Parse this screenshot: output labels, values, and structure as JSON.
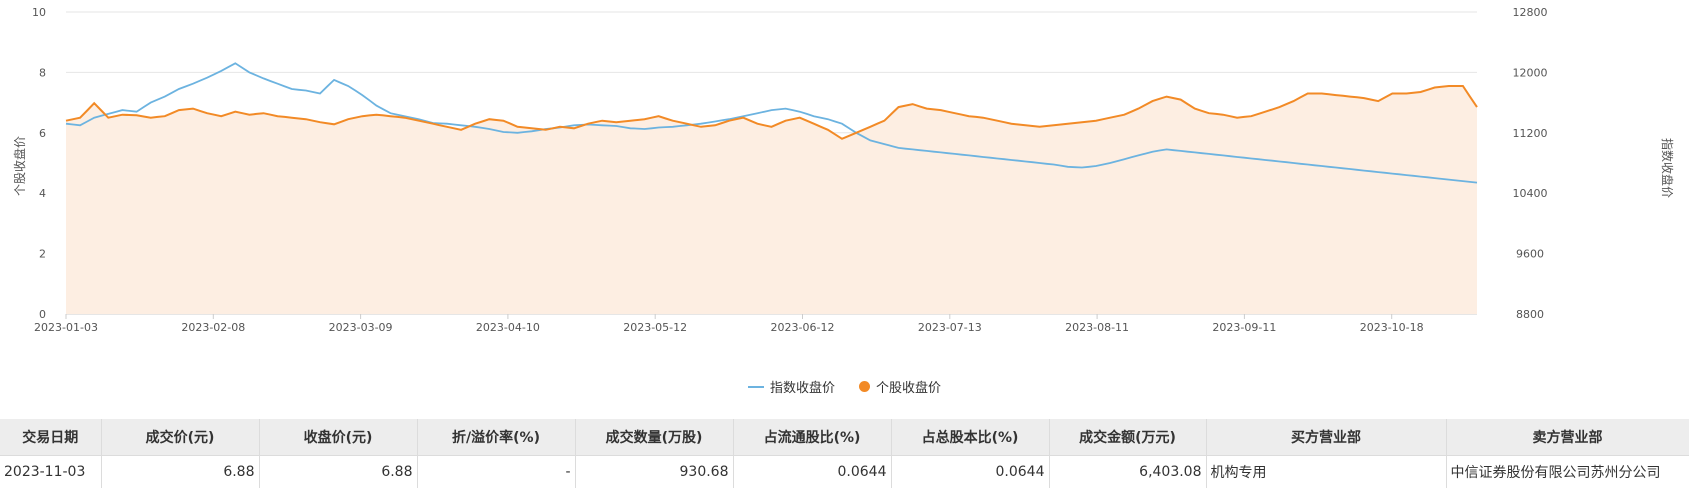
{
  "colors": {
    "index_line": "#6cb3e0",
    "stock_line": "#f28a26",
    "stock_area": "#fdeee2",
    "grid": "#e6e6e6"
  },
  "legend": {
    "index_label": "指数收盘价",
    "stock_label": "个股收盘价"
  },
  "chart_data": {
    "type": "line",
    "x_ticks": [
      "2023-01-03",
      "2023-02-08",
      "2023-03-09",
      "2023-04-10",
      "2023-05-12",
      "2023-06-12",
      "2023-07-13",
      "2023-08-11",
      "2023-09-11",
      "2023-10-18"
    ],
    "n_points": 201,
    "ylabel_left": "个股收盘价",
    "ylabel_right": "指数收盘价",
    "ylim_left": [
      0,
      10
    ],
    "yticks_left": [
      "0",
      "2",
      "4",
      "6",
      "8",
      "10"
    ],
    "ylim_right": [
      8800,
      12800
    ],
    "yticks_right": [
      "8800",
      "9600",
      "10400",
      "11200",
      "12000",
      "12800"
    ],
    "legend_position": "bottom-center",
    "grid": true,
    "series": [
      {
        "name": "个股收盘价",
        "axis": "left",
        "style": "line-area",
        "anchors": [
          [
            0,
            6.4
          ],
          [
            2,
            6.5
          ],
          [
            4,
            6.98
          ],
          [
            6,
            6.5
          ],
          [
            8,
            6.6
          ],
          [
            10,
            6.58
          ],
          [
            12,
            6.5
          ],
          [
            14,
            6.55
          ],
          [
            16,
            6.75
          ],
          [
            18,
            6.8
          ],
          [
            20,
            6.65
          ],
          [
            22,
            6.55
          ],
          [
            24,
            6.7
          ],
          [
            26,
            6.6
          ],
          [
            28,
            6.65
          ],
          [
            30,
            6.55
          ],
          [
            32,
            6.5
          ],
          [
            34,
            6.45
          ],
          [
            36,
            6.35
          ],
          [
            38,
            6.28
          ],
          [
            40,
            6.45
          ],
          [
            42,
            6.55
          ],
          [
            44,
            6.6
          ],
          [
            46,
            6.55
          ],
          [
            48,
            6.5
          ],
          [
            50,
            6.4
          ],
          [
            52,
            6.3
          ],
          [
            54,
            6.2
          ],
          [
            56,
            6.1
          ],
          [
            58,
            6.3
          ],
          [
            60,
            6.45
          ],
          [
            62,
            6.4
          ],
          [
            64,
            6.2
          ],
          [
            66,
            6.15
          ],
          [
            68,
            6.1
          ],
          [
            70,
            6.2
          ],
          [
            72,
            6.15
          ],
          [
            74,
            6.3
          ],
          [
            76,
            6.4
          ],
          [
            78,
            6.35
          ],
          [
            80,
            6.4
          ],
          [
            82,
            6.45
          ],
          [
            84,
            6.55
          ],
          [
            86,
            6.4
          ],
          [
            88,
            6.3
          ],
          [
            90,
            6.2
          ],
          [
            92,
            6.25
          ],
          [
            94,
            6.4
          ],
          [
            96,
            6.5
          ],
          [
            98,
            6.3
          ],
          [
            100,
            6.2
          ],
          [
            102,
            6.4
          ],
          [
            104,
            6.5
          ],
          [
            106,
            6.3
          ],
          [
            108,
            6.1
          ],
          [
            110,
            5.8
          ],
          [
            112,
            6.0
          ],
          [
            114,
            6.2
          ],
          [
            116,
            6.4
          ],
          [
            118,
            6.85
          ],
          [
            120,
            6.95
          ],
          [
            122,
            6.8
          ],
          [
            124,
            6.75
          ],
          [
            126,
            6.65
          ],
          [
            128,
            6.55
          ],
          [
            130,
            6.5
          ],
          [
            132,
            6.4
          ],
          [
            134,
            6.3
          ],
          [
            136,
            6.25
          ],
          [
            138,
            6.2
          ],
          [
            140,
            6.25
          ],
          [
            142,
            6.3
          ],
          [
            144,
            6.35
          ],
          [
            146,
            6.4
          ],
          [
            148,
            6.5
          ],
          [
            150,
            6.6
          ],
          [
            152,
            6.8
          ],
          [
            154,
            7.05
          ],
          [
            156,
            7.2
          ],
          [
            158,
            7.1
          ],
          [
            160,
            6.8
          ],
          [
            162,
            6.65
          ],
          [
            164,
            6.6
          ],
          [
            166,
            6.5
          ],
          [
            168,
            6.55
          ],
          [
            170,
            6.7
          ],
          [
            172,
            6.85
          ],
          [
            174,
            7.05
          ],
          [
            176,
            7.3
          ],
          [
            178,
            7.3
          ],
          [
            180,
            7.25
          ],
          [
            182,
            7.2
          ],
          [
            184,
            7.15
          ],
          [
            186,
            7.05
          ],
          [
            188,
            7.3
          ],
          [
            190,
            7.3
          ],
          [
            192,
            7.35
          ],
          [
            194,
            7.5
          ],
          [
            196,
            7.55
          ],
          [
            198,
            7.55
          ],
          [
            200,
            6.85
          ]
        ]
      },
      {
        "name": "指数收盘价",
        "axis": "right",
        "style": "line",
        "anchors": [
          [
            0,
            11320
          ],
          [
            2,
            11300
          ],
          [
            4,
            11400
          ],
          [
            6,
            11450
          ],
          [
            8,
            11500
          ],
          [
            10,
            11480
          ],
          [
            12,
            11600
          ],
          [
            14,
            11680
          ],
          [
            16,
            11780
          ],
          [
            18,
            11850
          ],
          [
            20,
            11930
          ],
          [
            22,
            12020
          ],
          [
            24,
            12120
          ],
          [
            26,
            12000
          ],
          [
            28,
            11920
          ],
          [
            30,
            11850
          ],
          [
            32,
            11780
          ],
          [
            34,
            11760
          ],
          [
            36,
            11720
          ],
          [
            38,
            11900
          ],
          [
            40,
            11820
          ],
          [
            42,
            11700
          ],
          [
            44,
            11560
          ],
          [
            46,
            11460
          ],
          [
            48,
            11420
          ],
          [
            50,
            11380
          ],
          [
            52,
            11330
          ],
          [
            54,
            11320
          ],
          [
            56,
            11300
          ],
          [
            58,
            11280
          ],
          [
            60,
            11250
          ],
          [
            62,
            11210
          ],
          [
            64,
            11200
          ],
          [
            66,
            11220
          ],
          [
            68,
            11250
          ],
          [
            70,
            11270
          ],
          [
            72,
            11300
          ],
          [
            74,
            11310
          ],
          [
            76,
            11300
          ],
          [
            78,
            11290
          ],
          [
            80,
            11260
          ],
          [
            82,
            11250
          ],
          [
            84,
            11270
          ],
          [
            86,
            11280
          ],
          [
            88,
            11300
          ],
          [
            90,
            11320
          ],
          [
            92,
            11350
          ],
          [
            94,
            11380
          ],
          [
            96,
            11420
          ],
          [
            98,
            11460
          ],
          [
            100,
            11500
          ],
          [
            102,
            11520
          ],
          [
            104,
            11480
          ],
          [
            106,
            11420
          ],
          [
            108,
            11380
          ],
          [
            110,
            11320
          ],
          [
            112,
            11200
          ],
          [
            114,
            11100
          ],
          [
            116,
            11050
          ],
          [
            118,
            11000
          ],
          [
            120,
            10980
          ],
          [
            122,
            10960
          ],
          [
            124,
            10940
          ],
          [
            126,
            10920
          ],
          [
            128,
            10900
          ],
          [
            130,
            10880
          ],
          [
            132,
            10860
          ],
          [
            134,
            10840
          ],
          [
            136,
            10820
          ],
          [
            138,
            10800
          ],
          [
            140,
            10780
          ],
          [
            142,
            10750
          ],
          [
            144,
            10740
          ],
          [
            146,
            10760
          ],
          [
            148,
            10800
          ],
          [
            150,
            10850
          ],
          [
            152,
            10900
          ],
          [
            154,
            10950
          ],
          [
            156,
            10980
          ],
          [
            158,
            10960
          ],
          [
            160,
            10940
          ],
          [
            162,
            10920
          ],
          [
            164,
            10900
          ],
          [
            166,
            10880
          ],
          [
            168,
            10860
          ],
          [
            170,
            10840
          ],
          [
            172,
            10820
          ],
          [
            174,
            10800
          ],
          [
            176,
            10780
          ],
          [
            178,
            10760
          ],
          [
            180,
            10740
          ],
          [
            182,
            10720
          ],
          [
            184,
            10700
          ],
          [
            186,
            10680
          ],
          [
            188,
            10660
          ],
          [
            190,
            10640
          ],
          [
            192,
            10620
          ],
          [
            194,
            10600
          ],
          [
            196,
            10580
          ],
          [
            198,
            10560
          ],
          [
            200,
            10540
          ]
        ]
      }
    ]
  },
  "table": {
    "headers": [
      "交易日期",
      "成交价(元)",
      "收盘价(元)",
      "折/溢价率(%)",
      "成交数量(万股)",
      "占流通股比(%)",
      "占总股本比(%)",
      "成交金额(万元)",
      "买方营业部",
      "卖方营业部"
    ],
    "row": [
      "2023-11-03",
      "6.88",
      "6.88",
      "-",
      "930.68",
      "0.0644",
      "0.0644",
      "6,403.08",
      "机构专用",
      "中信证券股份有限公司苏州分公司"
    ]
  }
}
